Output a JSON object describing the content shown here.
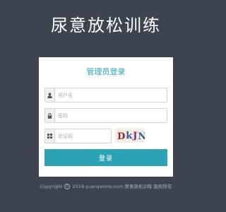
{
  "site": {
    "title": "尿意放松训练"
  },
  "login": {
    "heading": "管理员登录",
    "username_placeholder": "用户名",
    "password_placeholder": "密码",
    "captcha_placeholder": "验证码",
    "captcha_text": "DkJN",
    "submit_label": "登录"
  },
  "icons": {
    "username": "user-icon",
    "password": "lock-icon",
    "captcha": "grid-icon"
  },
  "footer": {
    "prefix": "Copyright",
    "symbol": "C",
    "text": "2019-yuanyecms.com  尿意放松训练 版权所有"
  },
  "colors": {
    "background": "#3d4450",
    "accent": "#23a4b9",
    "button": "#2ba3b5"
  }
}
